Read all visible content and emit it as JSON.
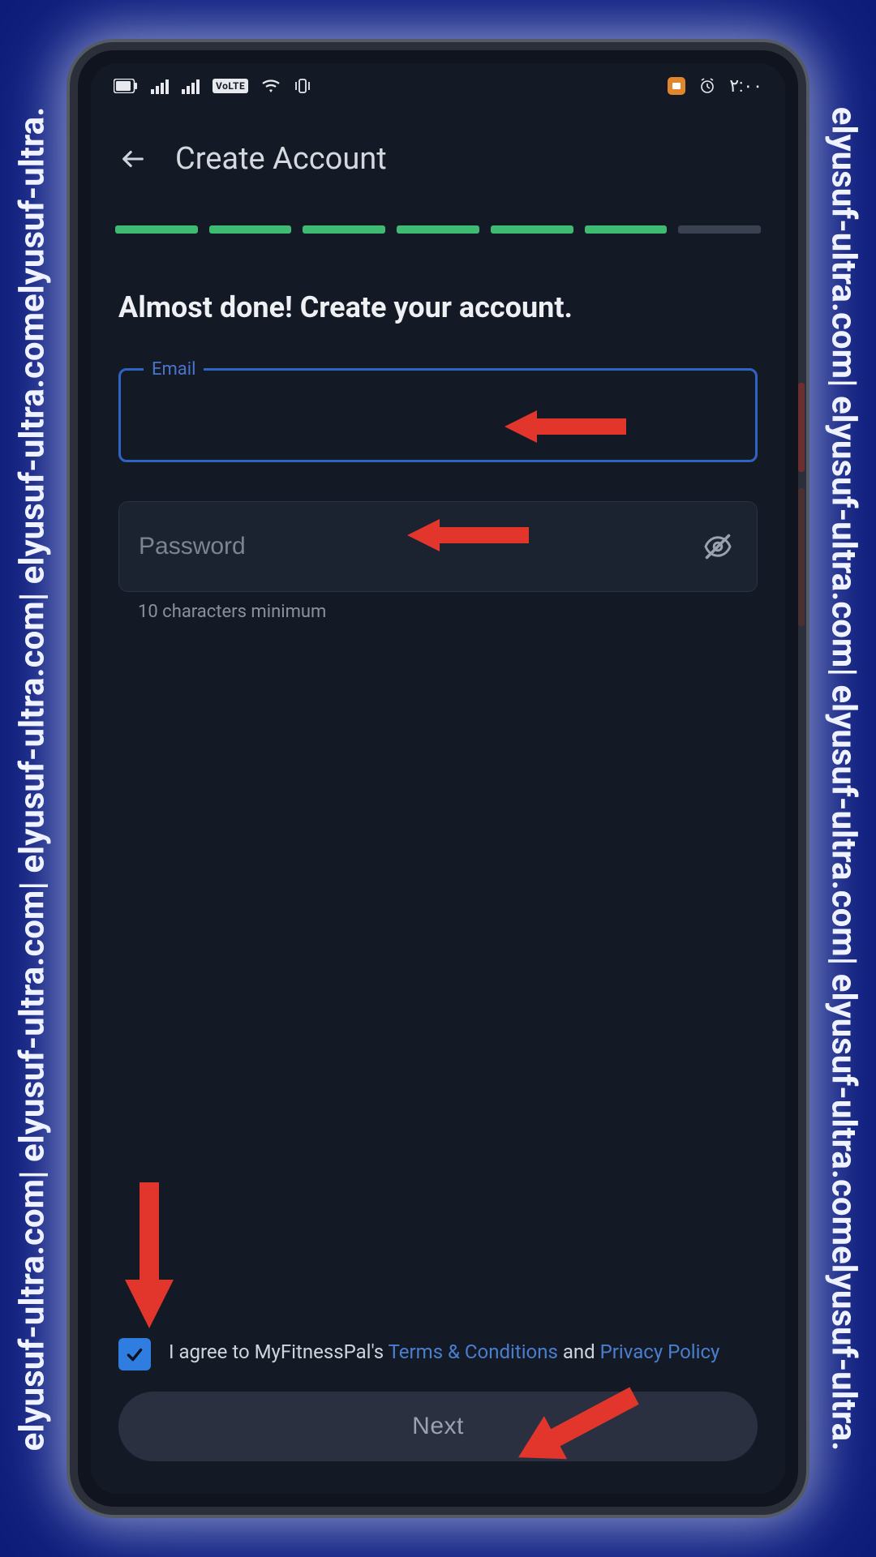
{
  "watermark_text": "elyusuf-ultra.com| elyusuf-ultra.com| elyusuf-ultra.com| elyusuf-ultra.comelyusuf-ultra.",
  "status_bar": {
    "volte": "VoLTE",
    "time": "٢:٠٠"
  },
  "header": {
    "title": "Create Account"
  },
  "progress": {
    "total_segments": 7,
    "completed_segments": 6
  },
  "heading": "Almost done! Create your account.",
  "form": {
    "email_label": "Email",
    "email_value": "",
    "password_placeholder": "Password",
    "password_value": "",
    "password_helper": "10 characters minimum"
  },
  "consent": {
    "checked": true,
    "prefix": "I agree to MyFitnessPal's ",
    "terms_link": "Terms & Conditions",
    "middle": " and ",
    "privacy_link": "Privacy Policy"
  },
  "next_button": "Next"
}
